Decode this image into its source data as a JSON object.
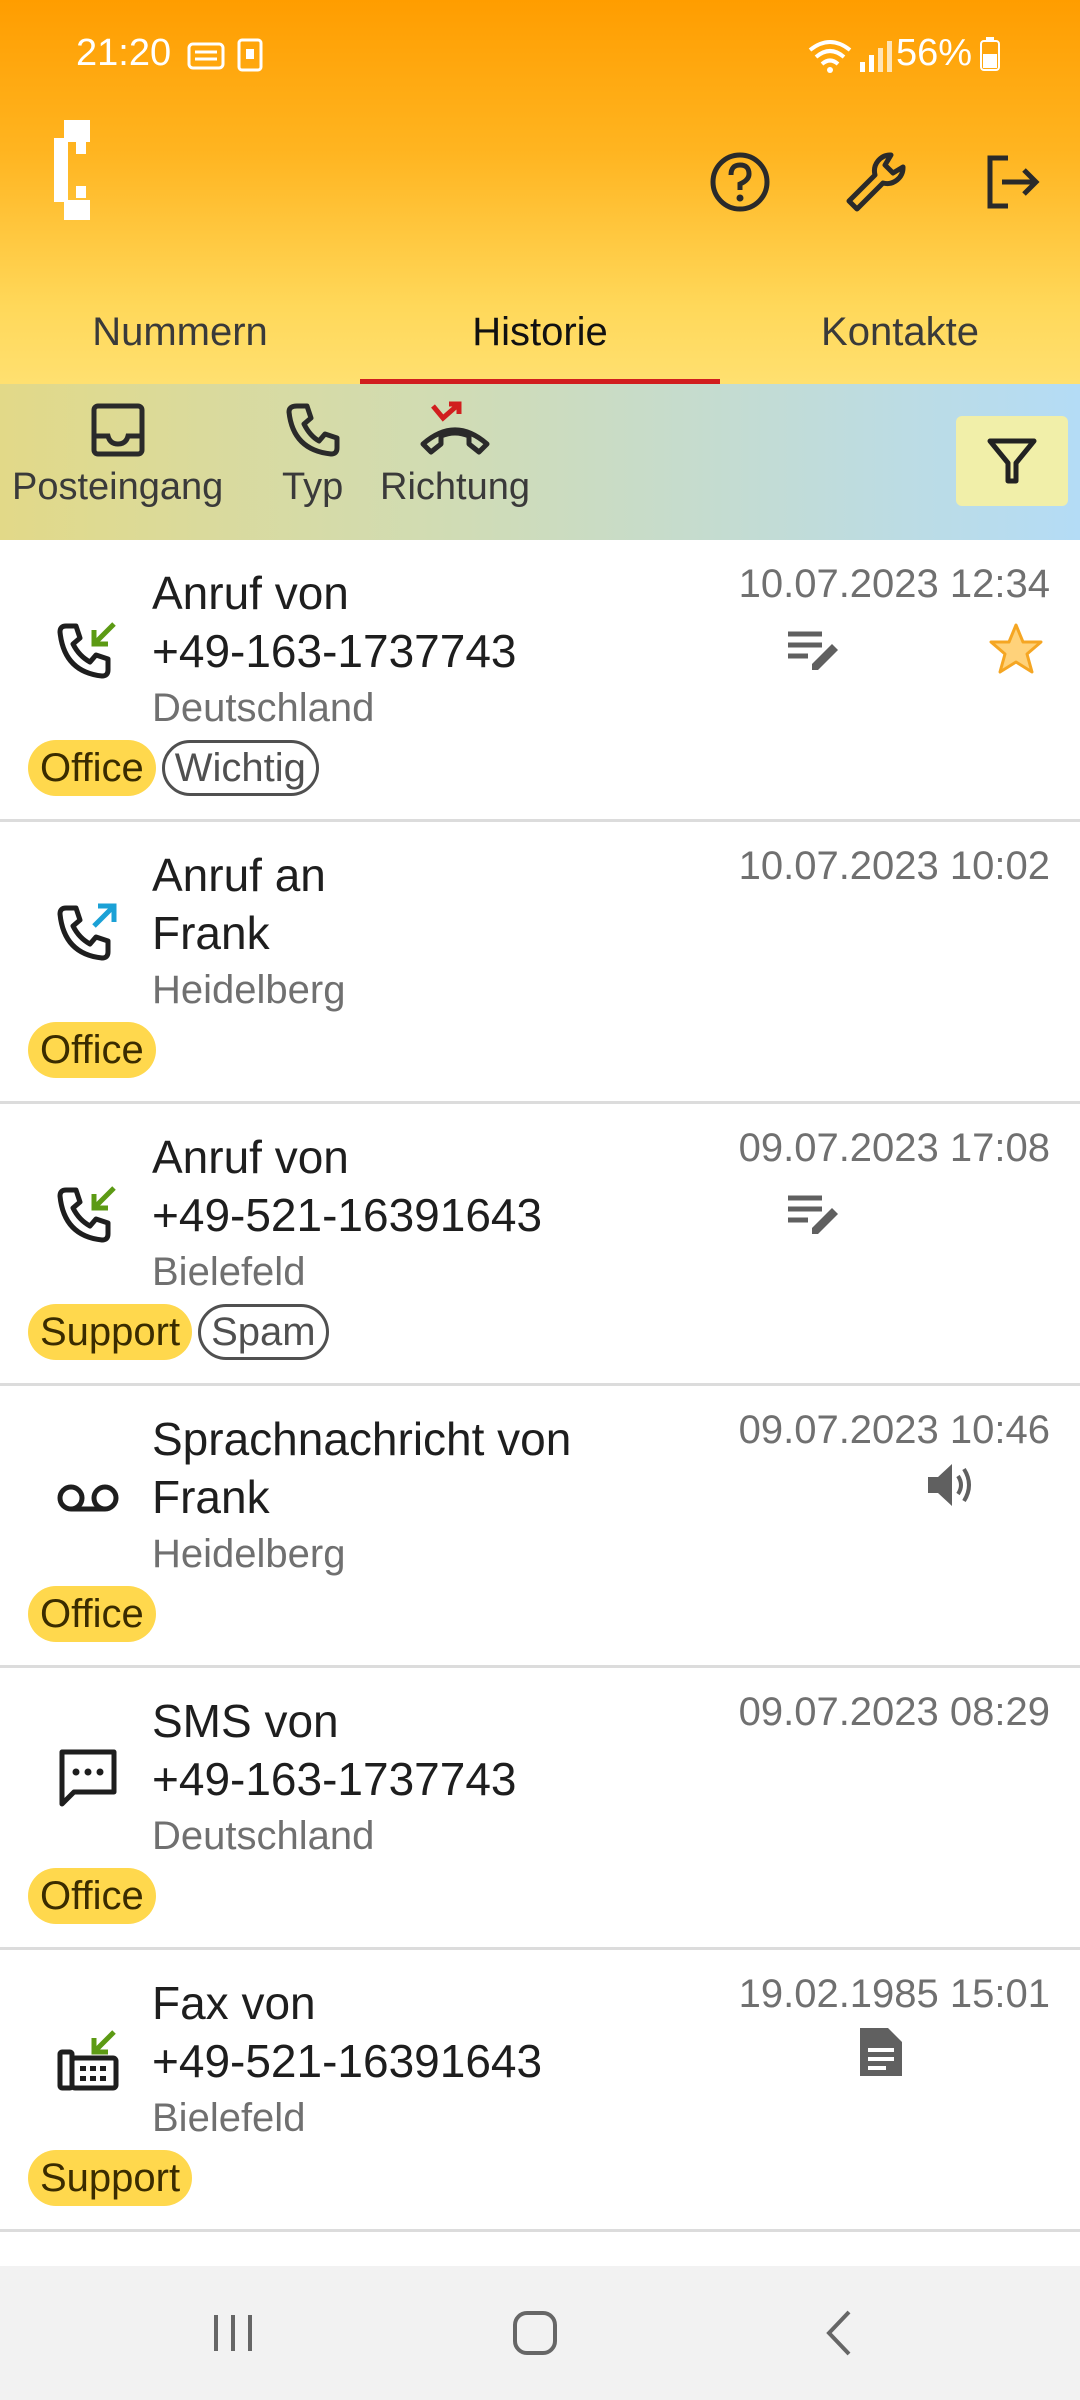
{
  "status": {
    "time": "21:20",
    "battery": "56%"
  },
  "tabs": [
    {
      "label": "Nummern",
      "active": false
    },
    {
      "label": "Historie",
      "active": true
    },
    {
      "label": "Kontakte",
      "active": false
    }
  ],
  "filters": [
    {
      "label": "Posteingang",
      "icon": "inbox-icon"
    },
    {
      "label": "Typ",
      "icon": "phone-icon"
    },
    {
      "label": "Richtung",
      "icon": "missed-call-icon"
    }
  ],
  "history": [
    {
      "kind": "incoming-call",
      "title": "Anruf von\n+49-163-1737743",
      "location": "Deutschland",
      "date": "10.07.2023 12:34",
      "tags": [
        {
          "label": "Office",
          "style": "fill"
        },
        {
          "label": "Wichtig",
          "style": "outline"
        }
      ],
      "note": true,
      "star": true
    },
    {
      "kind": "outgoing-call",
      "title": "Anruf an\nFrank",
      "location": "Heidelberg",
      "date": "10.07.2023 10:02",
      "tags": [
        {
          "label": "Office",
          "style": "fill"
        }
      ]
    },
    {
      "kind": "incoming-call",
      "title": "Anruf von\n+49-521-16391643",
      "location": "Bielefeld",
      "date": "09.07.2023 17:08",
      "tags": [
        {
          "label": "Support",
          "style": "fill"
        },
        {
          "label": "Spam",
          "style": "outline"
        }
      ],
      "note": true
    },
    {
      "kind": "voicemail",
      "title": "Sprachnachricht von\nFrank",
      "location": "Heidelberg",
      "date": "09.07.2023 10:46",
      "tags": [
        {
          "label": "Office",
          "style": "fill"
        }
      ],
      "audio": true
    },
    {
      "kind": "sms",
      "title": "SMS von\n+49-163-1737743",
      "location": "Deutschland",
      "date": "09.07.2023 08:29",
      "tags": [
        {
          "label": "Office",
          "style": "fill"
        }
      ]
    },
    {
      "kind": "fax",
      "title": "Fax von\n+49-521-16391643",
      "location": "Bielefeld",
      "date": "19.02.1985 15:01",
      "tags": [
        {
          "label": "Support",
          "style": "fill"
        }
      ],
      "document": true
    }
  ],
  "colors": {
    "accent": "#d11e1e",
    "tag": "#ffd84d",
    "incoming": "#5c9a14",
    "outgoing": "#1ba1d6",
    "star": "#ffc84a"
  }
}
